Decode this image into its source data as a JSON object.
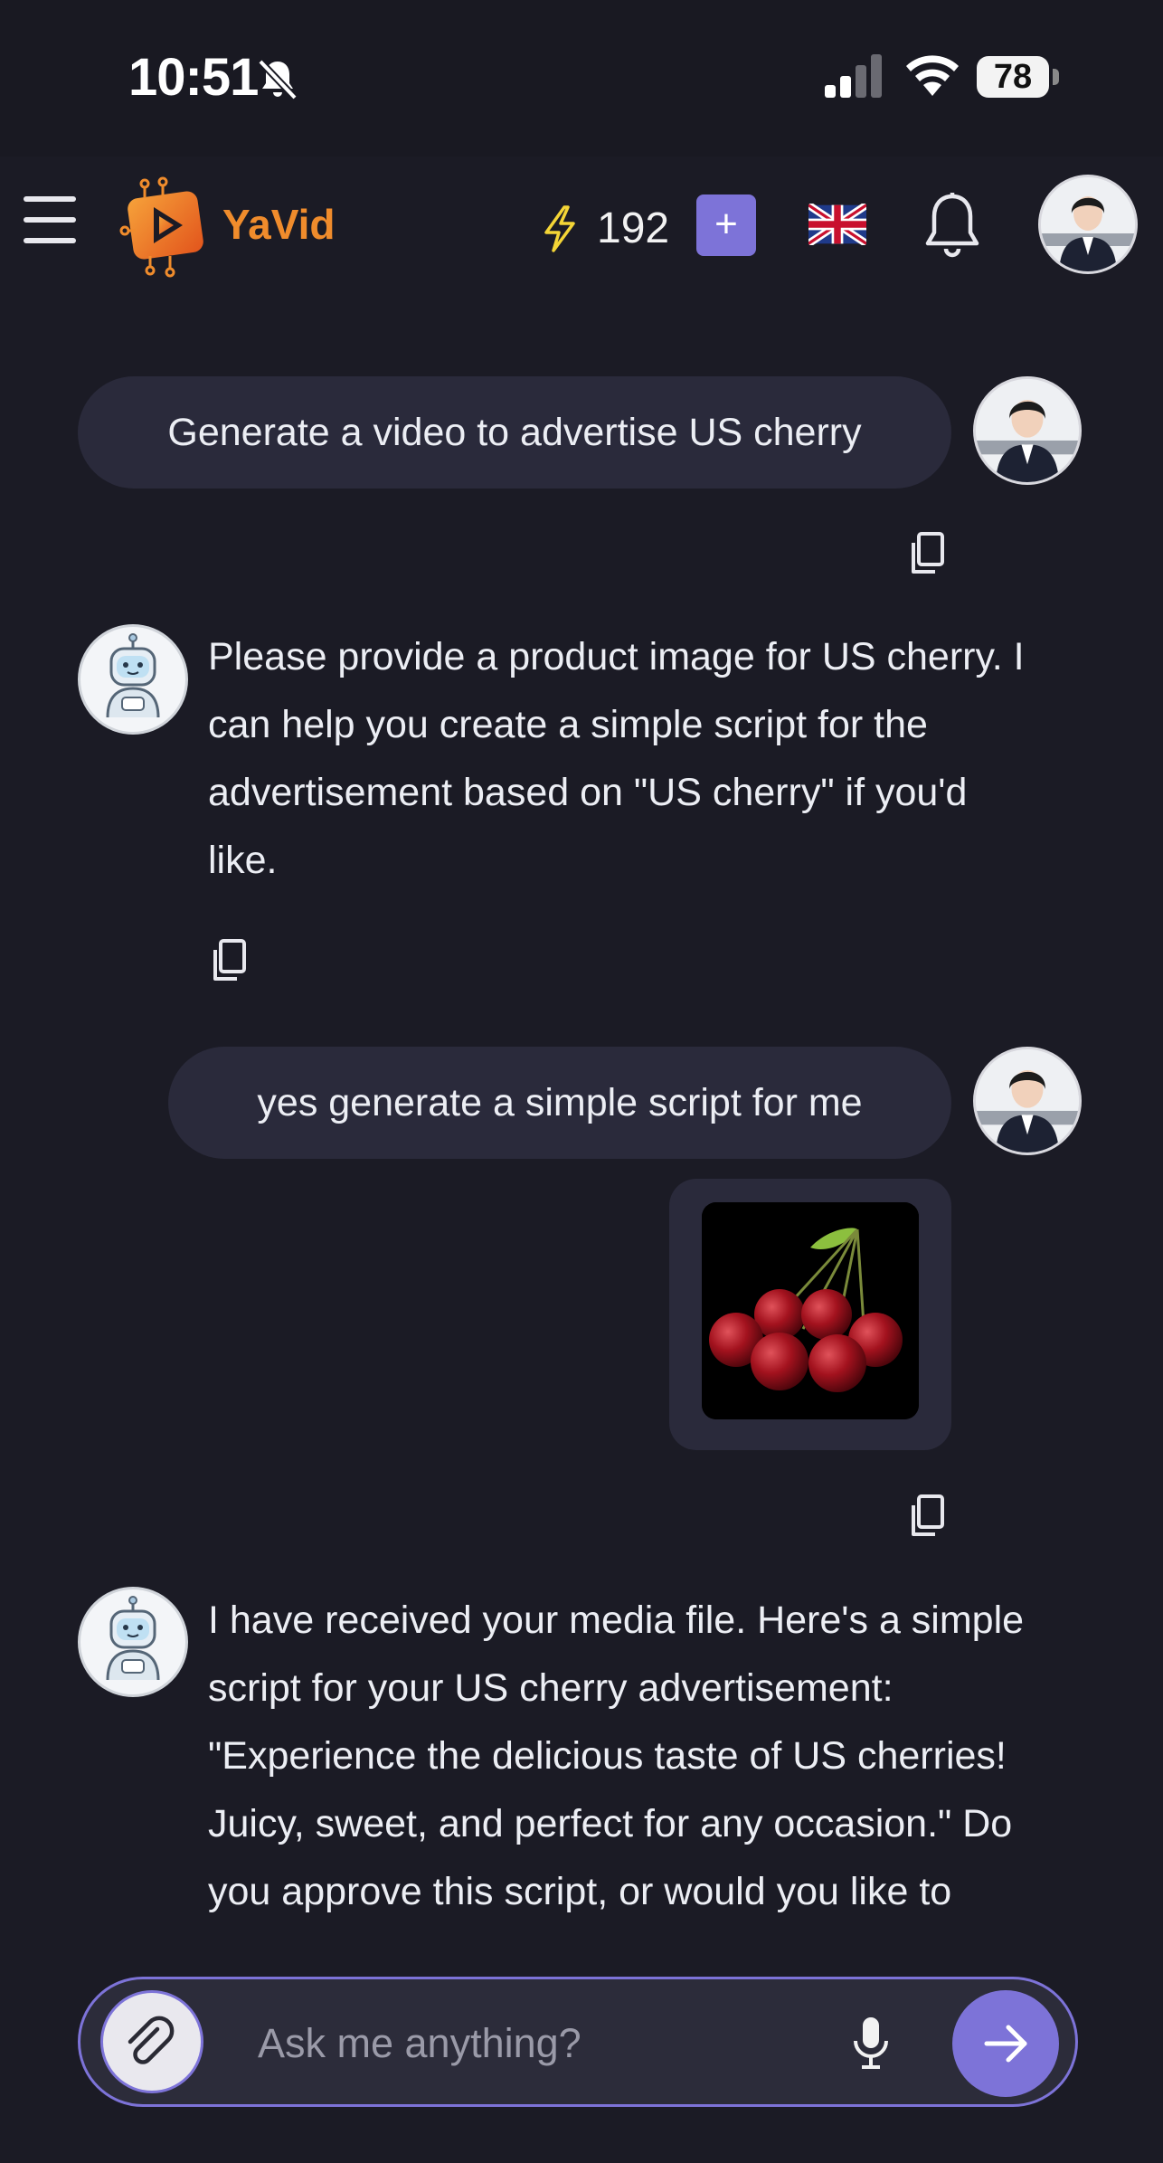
{
  "status_bar": {
    "time": "10:51",
    "battery": "78"
  },
  "header": {
    "app_name": "YaVid",
    "credits": "192",
    "plus_label": "+",
    "language_flag": "uk-flag-icon"
  },
  "chat": {
    "messages": [
      {
        "role": "user",
        "text": "Generate a video to advertise US cherry"
      },
      {
        "role": "bot",
        "lines": [
          "Please provide a product image for US cherry. I",
          "can help you create a simple script for the",
          "advertisement based on \"US cherry\" if you'd",
          "like."
        ]
      },
      {
        "role": "user",
        "text": "yes generate a simple script for me",
        "attachment": "cherry-image"
      },
      {
        "role": "bot",
        "lines": [
          "I have received your media file. Here's a simple",
          "script for your US cherry advertisement:",
          "\"Experience the delicious taste of US cherries!",
          "Juicy, sweet, and perfect for any occasion.\" Do",
          "you approve this script, or would you like to"
        ]
      }
    ]
  },
  "input": {
    "placeholder": "Ask me anything?"
  },
  "colors": {
    "background": "#1b1b25",
    "bubble": "#2a2a3b",
    "accent": "#7d73d8",
    "brand_orange": "#f08c2c",
    "bolt": "#f4d536"
  }
}
